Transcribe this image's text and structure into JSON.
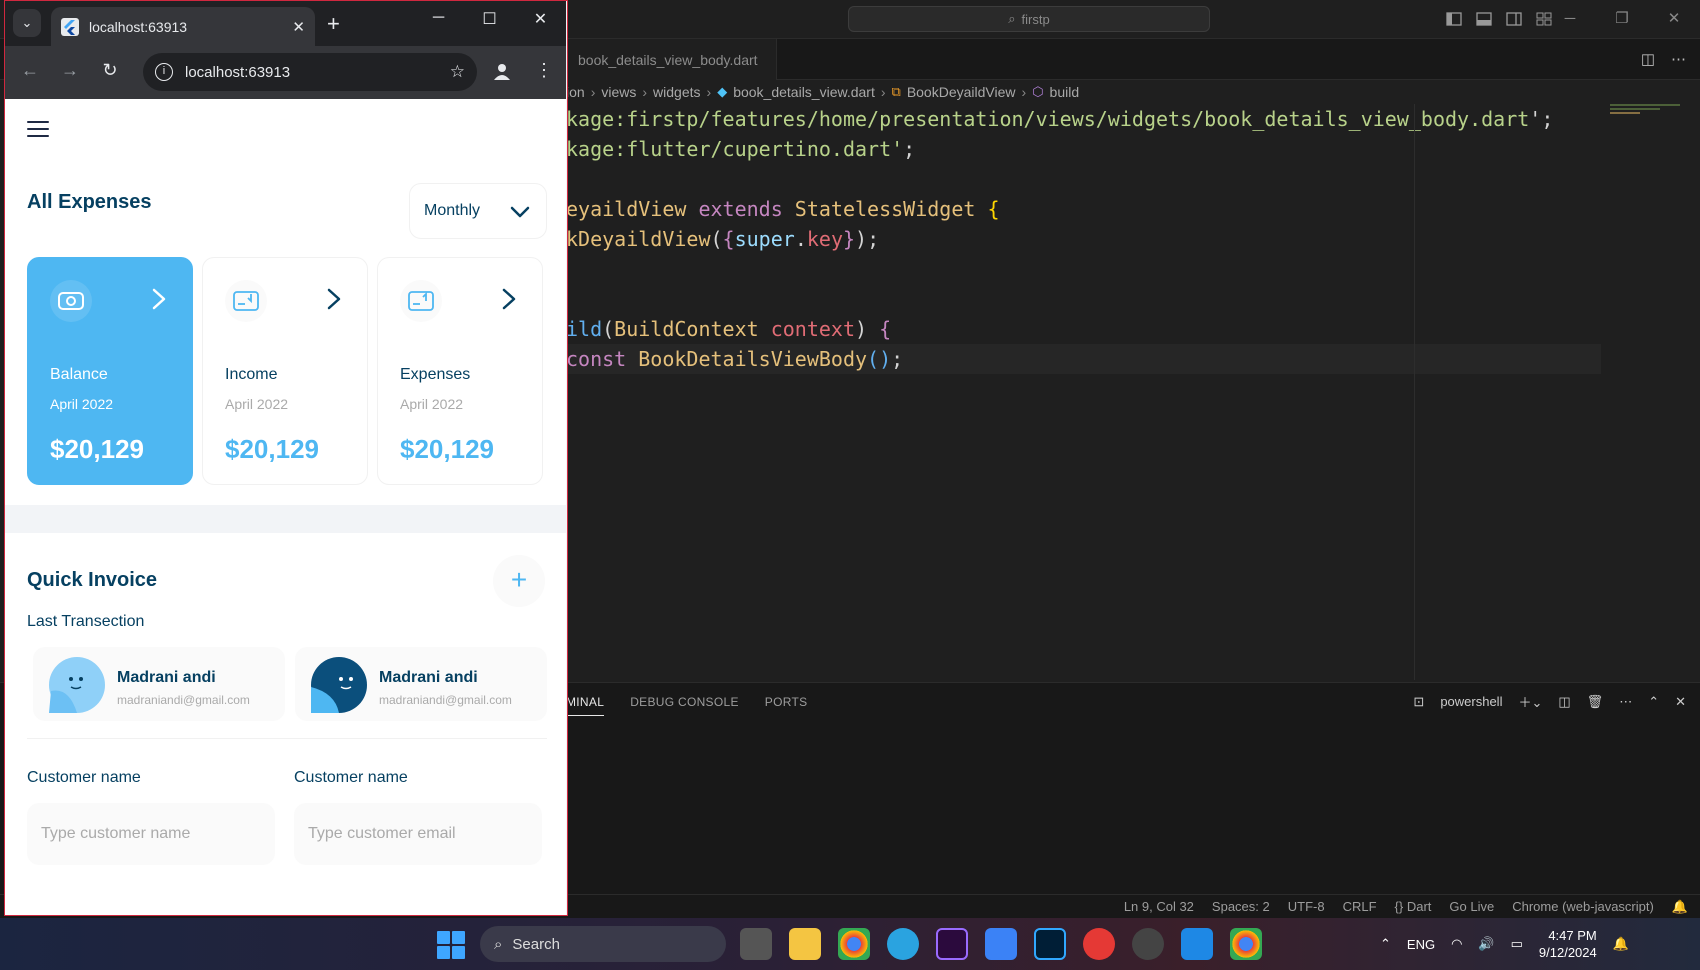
{
  "vscode": {
    "search": "firstp",
    "tab": "book_details_view_body.dart",
    "breadcrumbs": [
      "ion",
      "views",
      "widgets",
      "book_details_view.dart",
      "BookDeyaildView",
      "build"
    ],
    "code": [
      [
        {
          "c": "p",
          "t": "kage:firstp/features/home/presentation/views/widgets/book_details_view_body.dart"
        },
        {
          "c": "p",
          "t": "';"
        }
      ],
      [
        {
          "c": "s",
          "t": "kage:flutter/cupertino.dart'"
        },
        {
          "c": "p",
          "t": ";"
        }
      ],
      [],
      [
        {
          "c": "t",
          "t": "eyaildView "
        },
        {
          "c": "k",
          "t": "extends "
        },
        {
          "c": "t",
          "t": "StatelessWidget "
        },
        {
          "c": "b",
          "t": "{"
        }
      ],
      [
        {
          "c": "t",
          "t": "kDeyaildView"
        },
        {
          "c": "p",
          "t": "("
        },
        {
          "c": "k",
          "t": "{"
        },
        {
          "c": "v",
          "t": "super"
        },
        {
          "c": "p",
          "t": "."
        },
        {
          "c": "c",
          "t": "key"
        },
        {
          "c": "k",
          "t": "}"
        },
        {
          "c": "p",
          "t": ");"
        }
      ],
      [],
      [],
      [
        {
          "c": "f",
          "t": "ild"
        },
        {
          "c": "p",
          "t": "("
        },
        {
          "c": "t",
          "t": "BuildContext "
        },
        {
          "c": "c",
          "t": "context"
        },
        {
          "c": "p",
          "t": ") "
        },
        {
          "c": "k",
          "t": "{"
        }
      ],
      [
        {
          "c": "k",
          "t": "const "
        },
        {
          "c": "t",
          "t": "BookDetailsViewBody"
        },
        {
          "c": "f",
          "t": "()"
        },
        {
          "c": "p",
          "t": ";"
        }
      ]
    ],
    "panel_tabs": [
      "MINAL",
      "DEBUG CONSOLE",
      "PORTS"
    ],
    "terminal": "powershell",
    "status": [
      "Ln 9, Col 32",
      "Spaces: 2",
      "UTF-8",
      "CRLF",
      "{} Dart",
      "Go Live",
      "Chrome (web-javascript)"
    ]
  },
  "browser": {
    "tab_title": "localhost:63913",
    "url": "localhost:63913"
  },
  "app": {
    "expenses": {
      "title": "All Expenses",
      "period": "Monthly",
      "cards": [
        {
          "label": "Balance",
          "date": "April 2022",
          "amount": "$20,129"
        },
        {
          "label": "Income",
          "date": "April 2022",
          "amount": "$20,129"
        },
        {
          "label": "Expenses",
          "date": "April 2022",
          "amount": "$20,129"
        }
      ]
    },
    "invoice": {
      "title": "Quick Invoice",
      "subtitle": "Last Transection",
      "users": [
        {
          "name": "Madrani andi",
          "email": "madraniandi@gmail.com"
        },
        {
          "name": "Madrani andi",
          "email": "madraniandi@gmail.com"
        }
      ],
      "fields": [
        {
          "label": "Customer name",
          "placeholder": "Type customer name"
        },
        {
          "label": "Customer name",
          "placeholder": "Type customer email"
        }
      ]
    }
  },
  "taskbar": {
    "search": "Search",
    "lang": "ENG",
    "time": "4:47 PM",
    "date": "9/12/2024"
  },
  "colors": {
    "accent": "#4eb7f2",
    "heading": "#064061",
    "chrome_border": "#d0283f"
  }
}
